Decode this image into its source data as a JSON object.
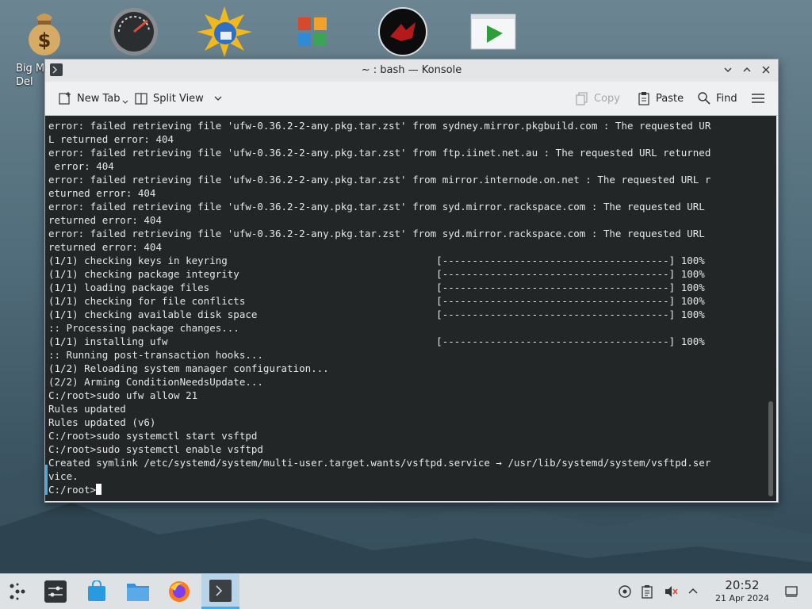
{
  "desktop": {
    "label": "Big M\nDel"
  },
  "window": {
    "title": "~ : bash — Konsole",
    "icon": "terminal-icon"
  },
  "toolbar": {
    "new_tab": "New Tab",
    "split_view": "Split View",
    "copy": "Copy",
    "paste": "Paste",
    "find": "Find"
  },
  "terminal": {
    "lines": [
      "error: failed retrieving file 'ufw-0.36.2-2-any.pkg.tar.zst' from sydney.mirror.pkgbuild.com : The requested UR",
      "L returned error: 404",
      "error: failed retrieving file 'ufw-0.36.2-2-any.pkg.tar.zst' from ftp.iinet.net.au : The requested URL returned",
      " error: 404",
      "error: failed retrieving file 'ufw-0.36.2-2-any.pkg.tar.zst' from mirror.internode.on.net : The requested URL r",
      "eturned error: 404",
      "error: failed retrieving file 'ufw-0.36.2-2-any.pkg.tar.zst' from syd.mirror.rackspace.com : The requested URL ",
      "returned error: 404",
      "error: failed retrieving file 'ufw-0.36.2-2-any.pkg.tar.zst' from syd.mirror.rackspace.com : The requested URL ",
      "returned error: 404",
      "(1/1) checking keys in keyring                                   [--------------------------------------] 100%",
      "(1/1) checking package integrity                                 [--------------------------------------] 100%",
      "(1/1) loading package files                                      [--------------------------------------] 100%",
      "(1/1) checking for file conflicts                                [--------------------------------------] 100%",
      "(1/1) checking available disk space                              [--------------------------------------] 100%",
      ":: Processing package changes...",
      "(1/1) installing ufw                                             [--------------------------------------] 100%",
      ":: Running post-transaction hooks...",
      "(1/2) Reloading system manager configuration...",
      "(2/2) Arming ConditionNeedsUpdate...",
      "C:/root>sudo ufw allow 21",
      "Rules updated",
      "Rules updated (v6)",
      "C:/root>sudo systemctl start vsftpd",
      "C:/root>sudo systemctl enable vsftpd",
      "Created symlink /etc/systemd/system/multi-user.target.wants/vsftpd.service → /usr/lib/systemd/system/vsftpd.ser",
      "vice."
    ],
    "prompt": "C:/root>"
  },
  "taskbar": {
    "time": "20:52",
    "date": "21 Apr 2024"
  },
  "colors": {
    "terminal_bg": "#232627",
    "accent": "#3daee9"
  }
}
